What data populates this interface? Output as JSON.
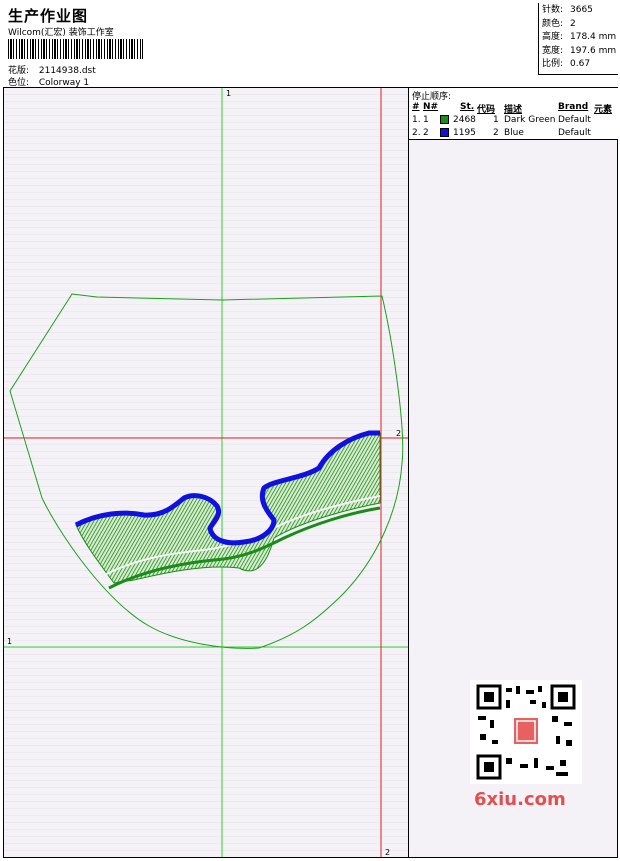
{
  "header": {
    "title": "生产作业图",
    "company": "Wilcom(汇宏) 装饰工作室",
    "design_label": "花版:",
    "design_value": "2114938.dst",
    "colorway_label": "色位:",
    "colorway_value": "Colorway 1"
  },
  "stats": {
    "stitches_label": "针数:",
    "stitches_value": "3665",
    "colors_label": "颜色:",
    "colors_value": "2",
    "height_label": "高度:",
    "height_value": "178.4 mm",
    "width_label": "宽度:",
    "width_value": "197.6 mm",
    "scale_label": "比例:",
    "scale_value": "0.67"
  },
  "stop_sequence": {
    "title": "停止顺序:",
    "columns": [
      "#",
      "N#",
      "St.",
      "代码",
      "描述",
      "Brand",
      "元素"
    ],
    "rows": [
      {
        "num": "1.",
        "n": "1",
        "color": "#1a8c1a",
        "st": "2468",
        "code": "1",
        "desc": "Dark Green",
        "brand": "Default"
      },
      {
        "num": "2.",
        "n": "2",
        "color": "#1010e0",
        "st": "1195",
        "code": "2",
        "desc": "Blue",
        "brand": "Default"
      }
    ]
  },
  "guides": {
    "v1": "1",
    "h1": "1",
    "v2": "2",
    "h2": "2"
  },
  "watermark": "6xiu.com",
  "colors": {
    "outline": "#1aa01a",
    "guide_green": "#30d030",
    "guide_red": "#e02020",
    "fill_green": "#1a8c1a",
    "border_blue": "#1010e0"
  }
}
